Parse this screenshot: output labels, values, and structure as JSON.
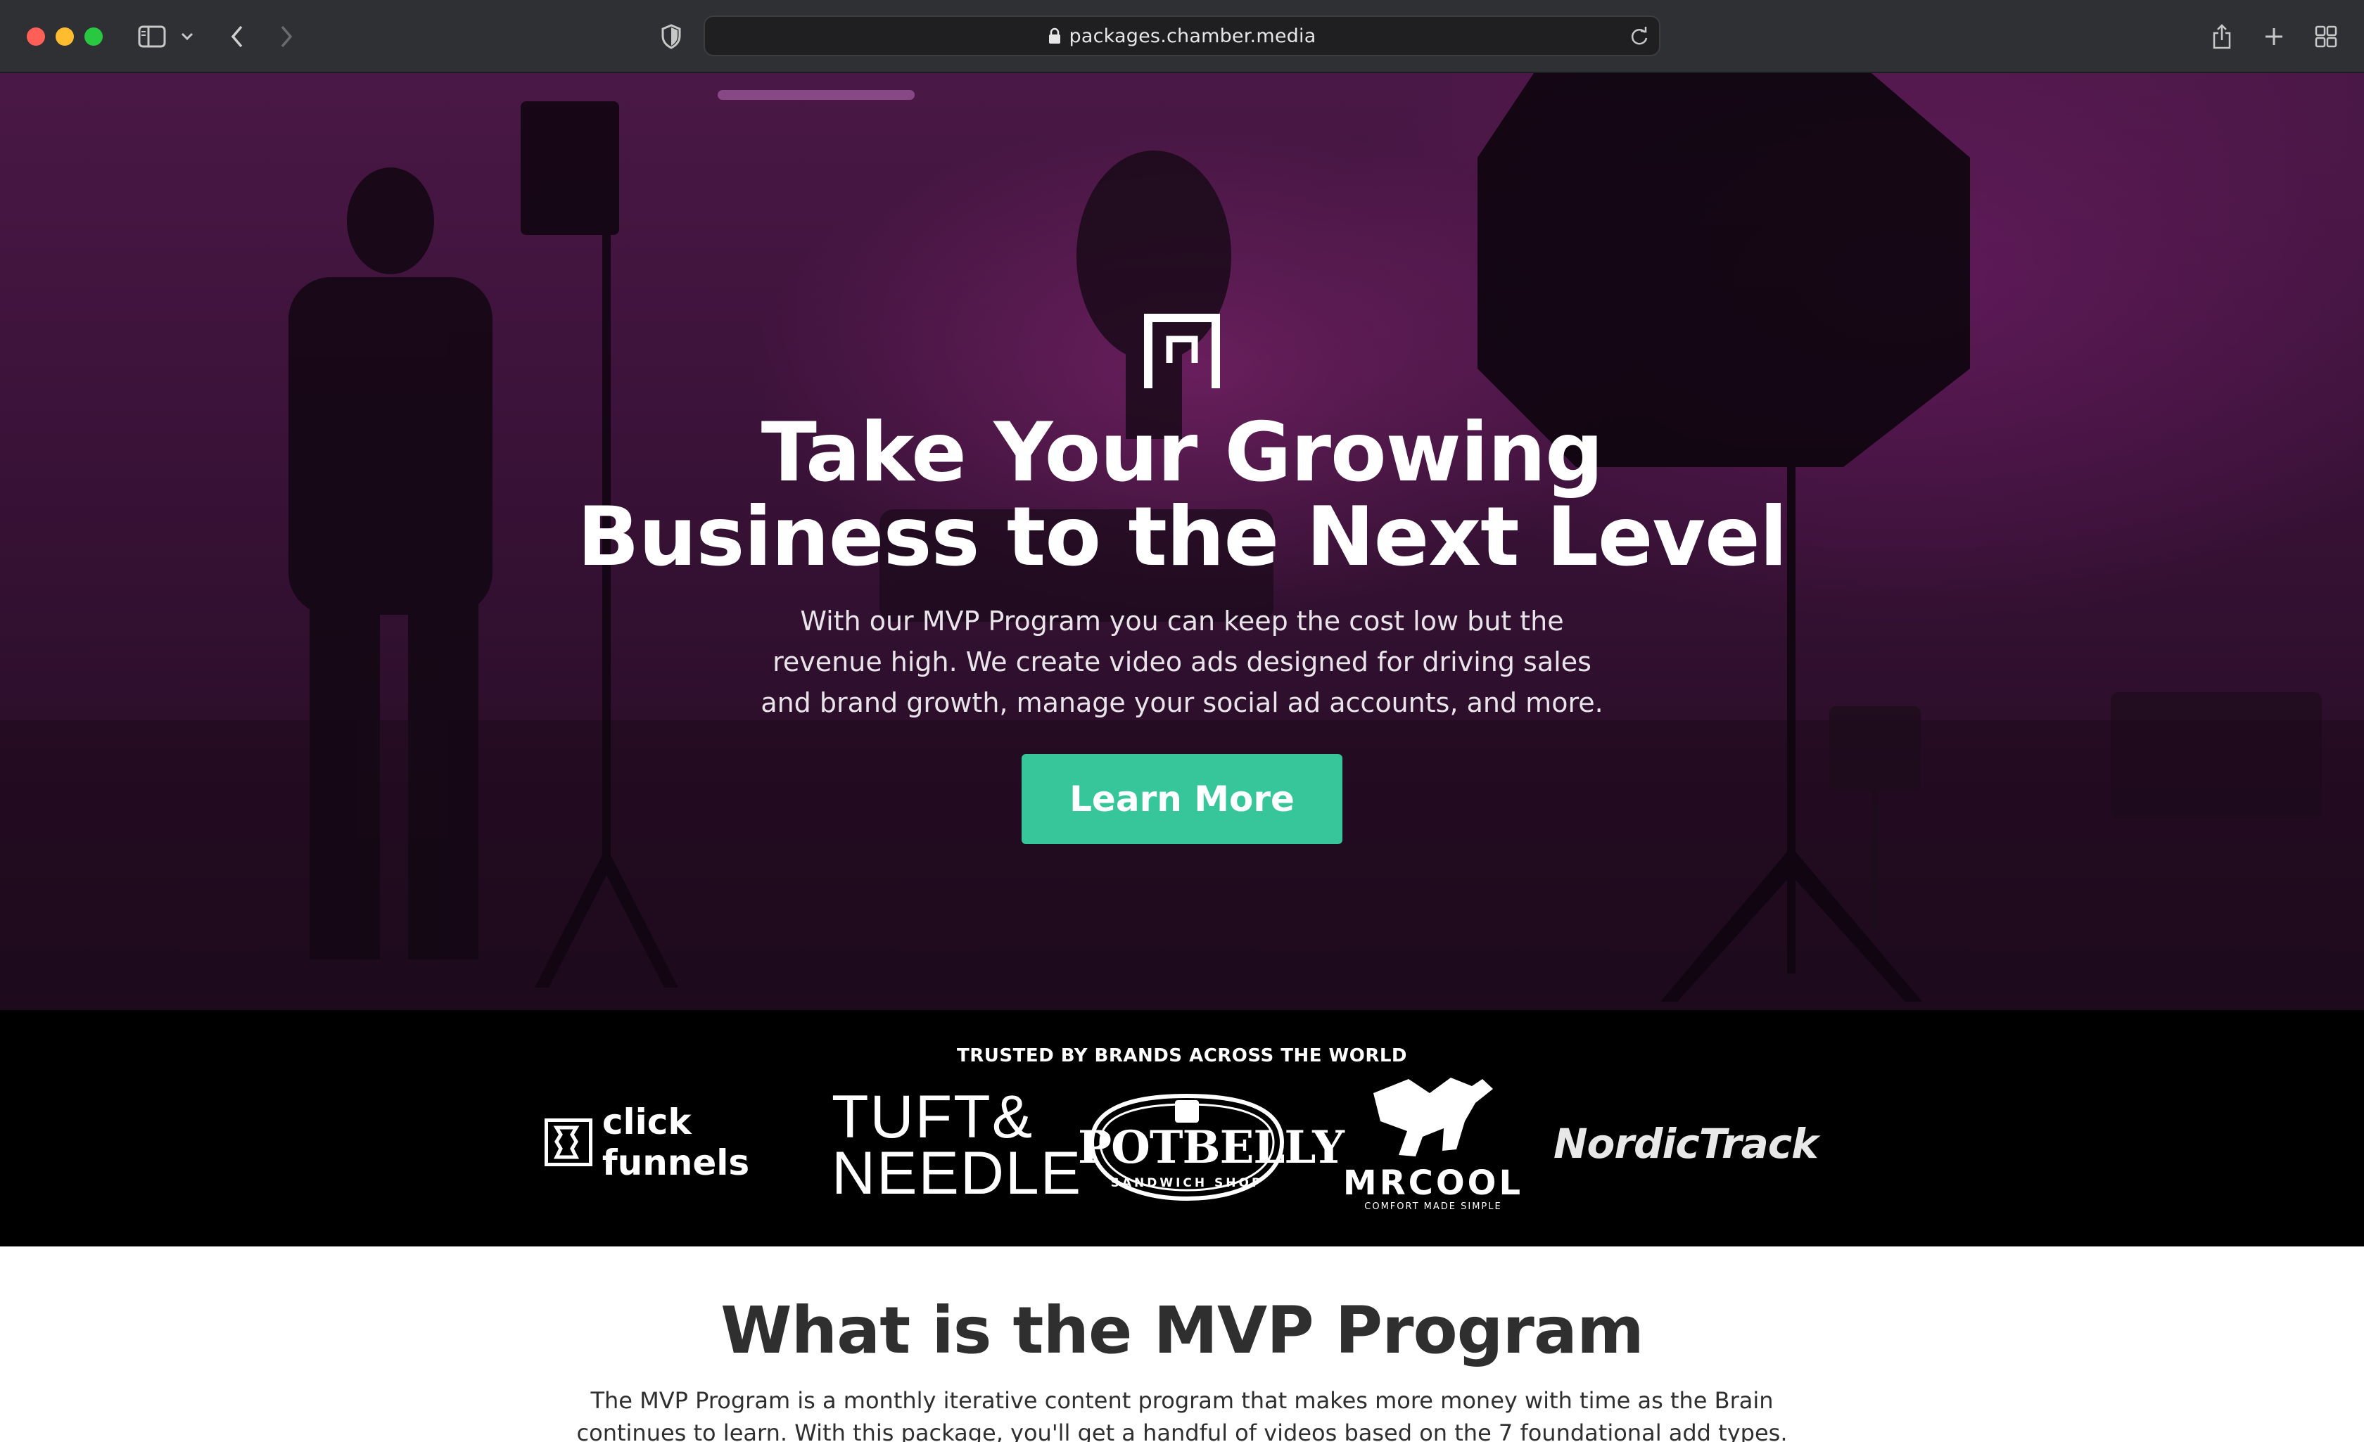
{
  "browser": {
    "url": "packages.chamber.media",
    "icons": [
      "sidebar-icon",
      "chevron-down-icon",
      "back-icon",
      "forward-icon",
      "shield-icon",
      "lock-icon",
      "reload-icon",
      "share-icon",
      "new-tab-icon",
      "tab-overview-icon"
    ]
  },
  "hero": {
    "logo": "chamber-media-logo",
    "title_lines": [
      "Take Your Growing",
      "Business to the Next Level"
    ],
    "subtitle_lines": [
      "With our MVP Program you can keep the cost low but the",
      "revenue high. We create video ads designed for driving sales",
      "and brand growth, manage your social ad accounts, and more."
    ],
    "cta_label": "Learn More"
  },
  "trusted": {
    "title": "TRUSTED BY BRANDS ACROSS THE WORLD",
    "brands": {
      "clickfunnels": "click funnels",
      "tuft_line1": "TUFT&",
      "tuft_line2": "NEEDLE",
      "potbelly": "POTBELLY",
      "potbelly_sub": "SANDWICH SHOP",
      "mrcool": "MRCOOL",
      "mrcool_sub": "COMFORT MADE SIMPLE",
      "nordictrack": "NordicTrack"
    }
  },
  "mvp": {
    "title": "What is the MVP Program",
    "body_lines": [
      "The MVP Program is a monthly iterative content program that makes more money with time as the Brain",
      "continues to learn. With this package, you'll get a handful of videos based on the 7 foundational add types."
    ]
  },
  "colors": {
    "cta": "#36c69a",
    "hero_tint": "#3a1238",
    "band": "#000000",
    "heading_dark": "#2f2f2f"
  }
}
